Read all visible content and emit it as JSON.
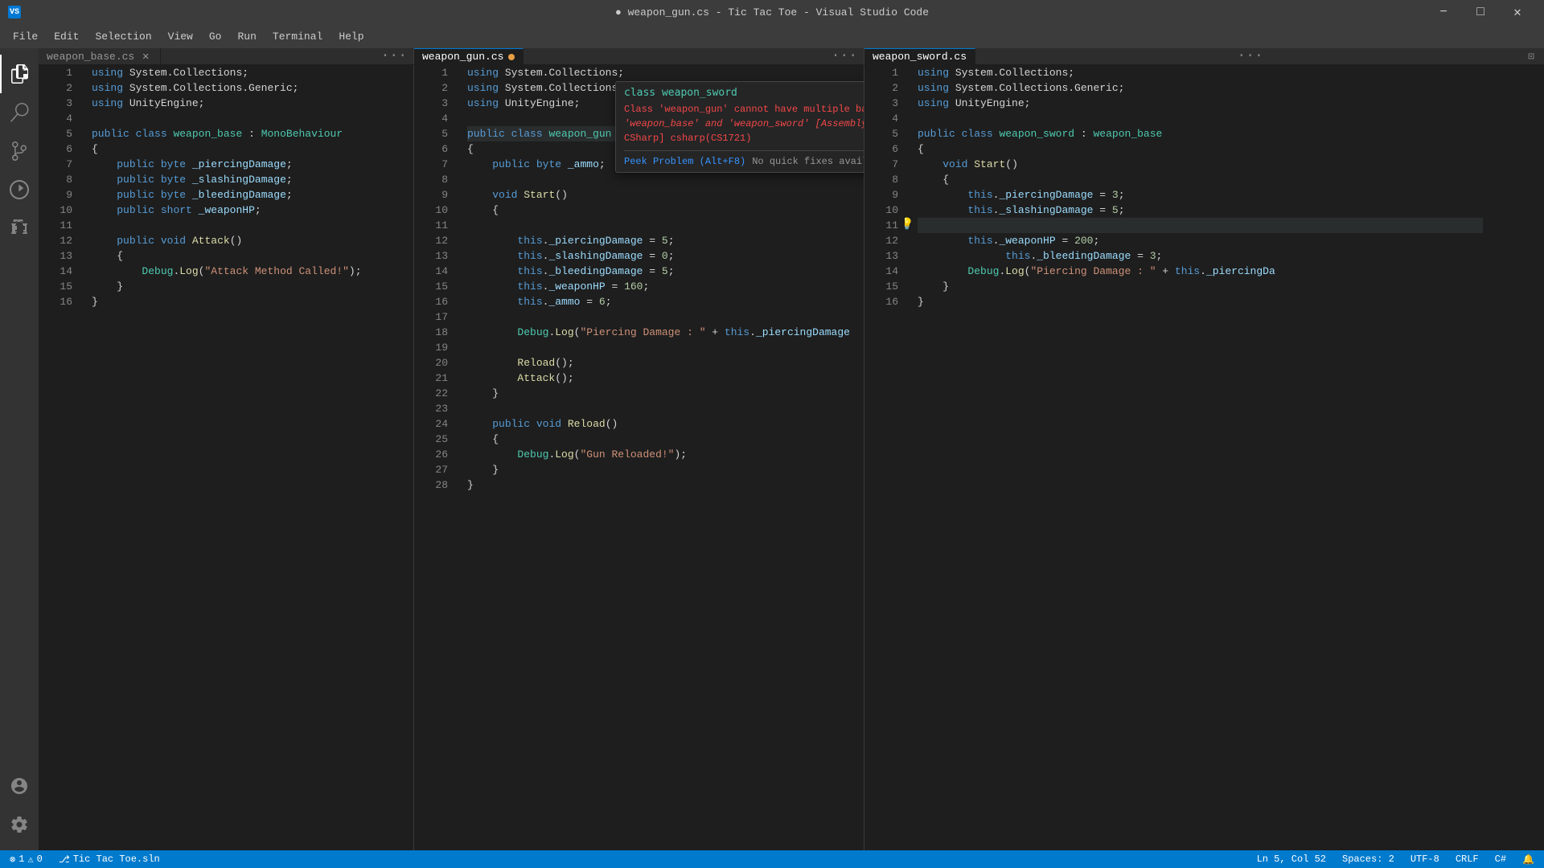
{
  "titleBar": {
    "title": "● weapon_gun.cs - Tic Tac Toe - Visual Studio Code",
    "buttons": [
      "minimize",
      "maximize",
      "close"
    ]
  },
  "menuBar": {
    "items": [
      "File",
      "Edit",
      "Selection",
      "View",
      "Go",
      "Run",
      "Terminal",
      "Help"
    ]
  },
  "tabs": {
    "pane1": {
      "label": "weapon_base.cs",
      "hasClose": true,
      "active": false
    },
    "pane2": {
      "label": "weapon_gun.cs",
      "modified": true,
      "active": true
    },
    "pane3": {
      "label": "weapon_sword.cs",
      "active": false
    }
  },
  "peekPopup": {
    "title": "class weapon_sword",
    "errorLine1": "Class 'weapon_gun' cannot have multiple base classes:",
    "errorLine2": "'weapon_base' and 'weapon_sword' [Assembly-",
    "errorLine3": "CSharp] csharp(CS1721)",
    "link": "Peek Problem (Alt+F8)",
    "noFixes": "No quick fixes available"
  },
  "editor1": {
    "filename": "weapon_base.cs",
    "lines": [
      {
        "n": 1,
        "code": "using System.Collections;"
      },
      {
        "n": 2,
        "code": "using System.Collections.Generic;"
      },
      {
        "n": 3,
        "code": "using UnityEngine;"
      },
      {
        "n": 4,
        "code": ""
      },
      {
        "n": 5,
        "code": "public class weapon_base : MonoBehaviour"
      },
      {
        "n": 6,
        "code": "{"
      },
      {
        "n": 7,
        "code": "    public byte _piercingDamage;"
      },
      {
        "n": 8,
        "code": "    public byte _slashingDamage;"
      },
      {
        "n": 9,
        "code": "    public byte _bleedingDamage;"
      },
      {
        "n": 10,
        "code": "    public short _weaponHP;"
      },
      {
        "n": 11,
        "code": ""
      },
      {
        "n": 12,
        "code": "    public void Attack()"
      },
      {
        "n": 13,
        "code": "    {"
      },
      {
        "n": 14,
        "code": "        Debug.Log(\"Attack Method Called!\");"
      },
      {
        "n": 15,
        "code": "    }"
      },
      {
        "n": 16,
        "code": "}"
      }
    ]
  },
  "editor2": {
    "filename": "weapon_gun.cs",
    "activeLine": 5,
    "lines": [
      {
        "n": 1,
        "code": "using System.Collections;"
      },
      {
        "n": 2,
        "code": "using System.Collections.Generic;"
      },
      {
        "n": 3,
        "code": "using UnityEngine;"
      },
      {
        "n": 4,
        "code": ""
      },
      {
        "n": 5,
        "code": "public class weapon_gun : weapon_base, weapon_sword"
      },
      {
        "n": 6,
        "code": "{"
      },
      {
        "n": 7,
        "code": "    public byte _ammo;"
      },
      {
        "n": 8,
        "code": ""
      },
      {
        "n": 9,
        "code": "    void Start()"
      },
      {
        "n": 10,
        "code": "    {"
      },
      {
        "n": 11,
        "code": ""
      },
      {
        "n": 12,
        "code": "        this._piercingDamage = 5;"
      },
      {
        "n": 13,
        "code": "        this._slashingDamage = 0;"
      },
      {
        "n": 14,
        "code": "        this._bleedingDamage = 5;"
      },
      {
        "n": 15,
        "code": "        this._weaponHP = 160;"
      },
      {
        "n": 16,
        "code": "        this._ammo = 6;"
      },
      {
        "n": 17,
        "code": ""
      },
      {
        "n": 18,
        "code": "        Debug.Log(\"Piercing Damage : \" + this._piercingDamage + \", Slashing D"
      },
      {
        "n": 19,
        "code": ""
      },
      {
        "n": 20,
        "code": "        Reload();"
      },
      {
        "n": 21,
        "code": "        Attack();"
      },
      {
        "n": 22,
        "code": "    }"
      },
      {
        "n": 23,
        "code": ""
      },
      {
        "n": 24,
        "code": "    public void Reload()"
      },
      {
        "n": 25,
        "code": "    {"
      },
      {
        "n": 26,
        "code": "        Debug.Log(\"Gun Reloaded!\");"
      },
      {
        "n": 27,
        "code": "    }"
      },
      {
        "n": 28,
        "code": "}"
      }
    ]
  },
  "editor3": {
    "filename": "weapon_sword.cs",
    "activeLine": 11,
    "lines": [
      {
        "n": 1,
        "code": "    m.Collections;"
      },
      {
        "n": 2,
        "code": "    m.Collections.Generic;"
      },
      {
        "n": 3,
        "code": "    yEngine;"
      },
      {
        "n": 4,
        "code": ""
      },
      {
        "n": 5,
        "code": "public class weapon_sword : weapon_base"
      },
      {
        "n": 6,
        "code": "{"
      },
      {
        "n": 7,
        "code": "    void Start()"
      },
      {
        "n": 8,
        "code": "    {"
      },
      {
        "n": 9,
        "code": "        this._piercingDamage = 3;"
      },
      {
        "n": 10,
        "code": "        this._slashingDamage = 5;"
      },
      {
        "n": 11,
        "code": "        this._bleedingDamage = 3;"
      },
      {
        "n": 12,
        "code": "        this._weaponHP = 200;"
      },
      {
        "n": 13,
        "code": ""
      },
      {
        "n": 14,
        "code": "        Debug.Log(\"Piercing Damage : \" + this._piercingDa"
      },
      {
        "n": 15,
        "code": "    }"
      },
      {
        "n": 16,
        "code": "}"
      }
    ]
  },
  "statusBar": {
    "errors": "1",
    "warnings": "0",
    "branch": "Tic Tac Toe.sln",
    "position": "Ln 5, Col 52",
    "spaces": "Spaces: 2",
    "encoding": "UTF-8",
    "lineEnding": "CRLF",
    "language": "C#"
  }
}
